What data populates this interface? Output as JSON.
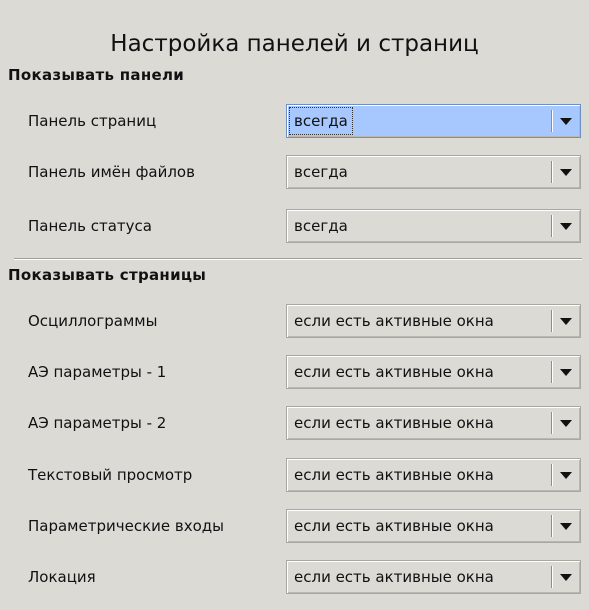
{
  "title": "Настройка панелей и страниц",
  "panels_section": {
    "heading": "Показывать панели",
    "rows": [
      {
        "label": "Панель страниц",
        "value": "всегда"
      },
      {
        "label": "Панель имён файлов",
        "value": "всегда"
      },
      {
        "label": "Панель статуса",
        "value": "всегда"
      }
    ]
  },
  "pages_section": {
    "heading": "Показывать страницы",
    "rows": [
      {
        "label": "Осциллограммы",
        "value": "если есть активные окна"
      },
      {
        "label": "АЭ параметры - 1",
        "value": "если есть активные окна"
      },
      {
        "label": "АЭ параметры - 2",
        "value": "если есть активные окна"
      },
      {
        "label": "Текстовый просмотр",
        "value": "если есть активные окна"
      },
      {
        "label": "Параметрические входы",
        "value": "если есть активные окна"
      },
      {
        "label": "Локация",
        "value": "если есть активные окна"
      }
    ]
  },
  "icons": {
    "dropdown": "chevron-down-icon"
  },
  "colors": {
    "background": "#dcdad5",
    "focus_highlight": "#a6c8ff"
  }
}
